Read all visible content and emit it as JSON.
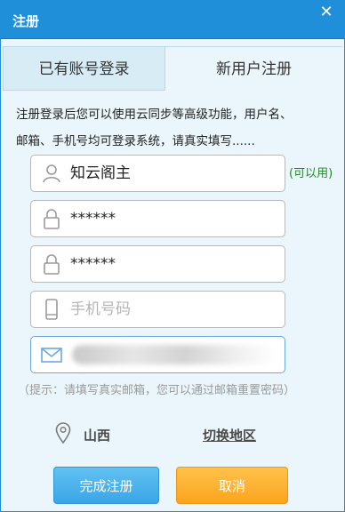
{
  "window": {
    "title": "注册",
    "close_glyph": "✕"
  },
  "tabs": {
    "login": "已有账号登录",
    "register": "新用户注册"
  },
  "info": {
    "line1": "注册登录后您可以使用云同步等高级功能，用户名、",
    "line2": "邮箱、手机号均可登录系统，请真实填写......"
  },
  "fields": {
    "username": {
      "value": "知云阁主",
      "status": "(可以用)",
      "icon": "user-icon"
    },
    "password": {
      "value": "******",
      "icon": "lock-icon"
    },
    "password_confirm": {
      "value": "******",
      "icon": "lock-icon"
    },
    "phone": {
      "placeholder": "手机号码",
      "icon": "phone-icon"
    },
    "email": {
      "value": "",
      "icon": "mail-icon"
    }
  },
  "hint": "（提示：请填写真实邮箱，您可以通过邮箱重置密码）",
  "region": {
    "name": "山西",
    "switch_label": "切换地区",
    "icon": "location-pin-icon"
  },
  "buttons": {
    "submit": "完成注册",
    "cancel": "取消"
  },
  "colors": {
    "titlebar": "#1e8fd8",
    "ok_status": "#1f8a22",
    "submit": "#3aa6e6",
    "cancel": "#fba41d"
  }
}
